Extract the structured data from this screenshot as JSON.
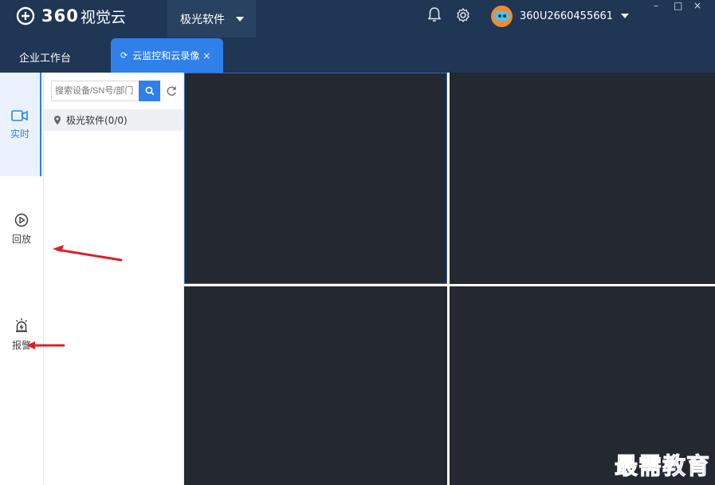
{
  "app": {
    "logo_text": "360",
    "logo_sub": "视觉云",
    "org_name": "极光软件",
    "username": "360U2660455661",
    "window_controls": [
      "–",
      "□",
      "×"
    ]
  },
  "tabs": {
    "home_label": "企业工作台",
    "active_label": "云监控和云录像",
    "active_refresh_glyph": "⟳",
    "close_glyph": "×"
  },
  "sidenav": {
    "items": [
      {
        "label": "实时",
        "icon": "camera-icon",
        "active": true
      },
      {
        "label": "回放",
        "icon": "play-circle-icon",
        "active": false
      },
      {
        "label": "报警",
        "icon": "alarm-icon",
        "active": false
      }
    ]
  },
  "panel": {
    "search_placeholder": "搜索设备/SN号/部门",
    "tree_root_label": "极光软件(0/0)"
  },
  "watermark": "最需教育",
  "colors": {
    "titlebar": "#1f3654",
    "accent": "#2f80e8",
    "video_cell": "#242830",
    "annotation_arrow": "#d8232a"
  }
}
